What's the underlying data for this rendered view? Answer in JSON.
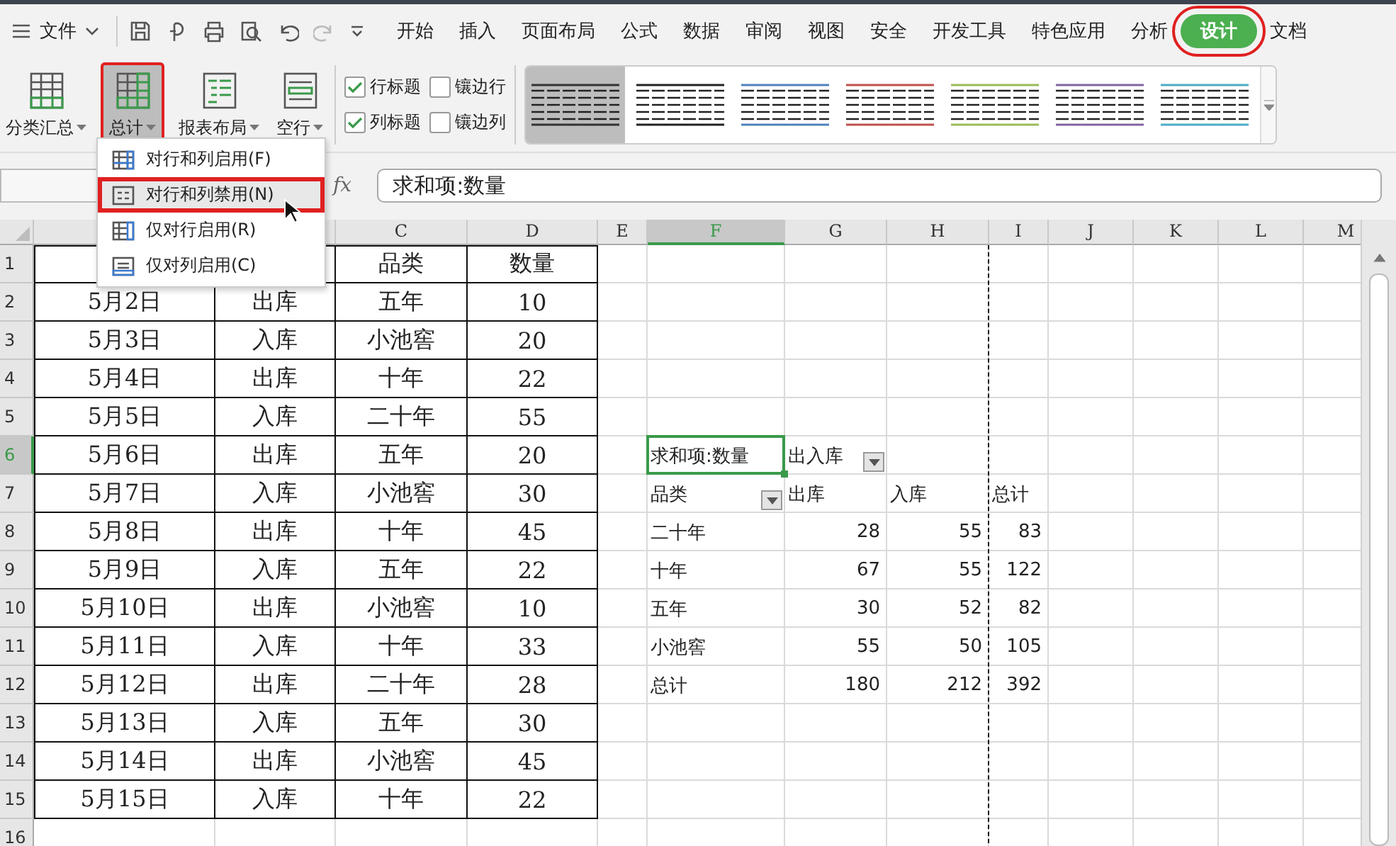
{
  "menu_bar": {
    "file_menu": "文件",
    "tabs": [
      {
        "label": "开始",
        "selected": false,
        "annotated": false
      },
      {
        "label": "插入",
        "selected": false,
        "annotated": false
      },
      {
        "label": "页面布局",
        "selected": false,
        "annotated": false
      },
      {
        "label": "公式",
        "selected": false,
        "annotated": false
      },
      {
        "label": "数据",
        "selected": false,
        "annotated": false
      },
      {
        "label": "审阅",
        "selected": false,
        "annotated": false
      },
      {
        "label": "视图",
        "selected": false,
        "annotated": false
      },
      {
        "label": "安全",
        "selected": false,
        "annotated": false
      },
      {
        "label": "开发工具",
        "selected": false,
        "annotated": false
      },
      {
        "label": "特色应用",
        "selected": false,
        "annotated": false
      },
      {
        "label": "分析",
        "selected": false,
        "annotated": false
      },
      {
        "label": "设计",
        "selected": true,
        "annotated": true
      },
      {
        "label": "文档",
        "selected": false,
        "annotated": false
      }
    ]
  },
  "ribbon": {
    "buttons": [
      {
        "label": "分类汇总",
        "pressed": false,
        "annotated": false
      },
      {
        "label": "总计",
        "pressed": true,
        "annotated": true
      },
      {
        "label": "报表布局",
        "pressed": false,
        "annotated": false
      },
      {
        "label": "空行",
        "pressed": false,
        "annotated": false
      }
    ],
    "checkboxes": [
      {
        "label": "行标题",
        "checked": true
      },
      {
        "label": "镶边行",
        "checked": false
      },
      {
        "label": "列标题",
        "checked": true
      },
      {
        "label": "镶边列",
        "checked": false
      }
    ],
    "styles": [
      {
        "color": "#333333",
        "selected": true
      },
      {
        "color": "#222222",
        "selected": false
      },
      {
        "color": "#4f81bd",
        "selected": false
      },
      {
        "color": "#c0504d",
        "selected": false
      },
      {
        "color": "#9bbb59",
        "selected": false
      },
      {
        "color": "#8064a2",
        "selected": false
      },
      {
        "color": "#4bacc6",
        "selected": false
      }
    ]
  },
  "formula_bar": {
    "fx": "fx",
    "value": "求和项:数量"
  },
  "dropdown_menu": {
    "items": [
      {
        "label": "对行和列启用(F)",
        "selected": false,
        "annotated": false
      },
      {
        "label": "对行和列禁用(N)",
        "selected": true,
        "annotated": true
      },
      {
        "label": "仅对行启用(R)",
        "selected": false,
        "annotated": false
      },
      {
        "label": "仅对列启用(C)",
        "selected": false,
        "annotated": false
      }
    ]
  },
  "sheet": {
    "columns": [
      {
        "selected": false
      },
      {
        "selected": false
      },
      {
        "label": "C",
        "selected": false
      },
      {
        "label": "D",
        "selected": false
      },
      {
        "label": "E",
        "selected": false
      },
      {
        "label": "F",
        "selected": true
      },
      {
        "label": "G",
        "selected": false
      },
      {
        "label": "H",
        "selected": false,
        "page_break_after": true
      },
      {
        "label": "I",
        "selected": false
      },
      {
        "label": "J",
        "selected": false
      },
      {
        "label": "K",
        "selected": false
      },
      {
        "label": "L",
        "selected": false
      },
      {
        "label": "M",
        "selected": false
      }
    ],
    "rows": [
      {
        "number": "1",
        "selected": false,
        "cells": [
          {
            "kind": "data"
          },
          {
            "kind": "data"
          },
          {
            "kind": "data",
            "text": "品类"
          },
          {
            "kind": "data",
            "text": "数量"
          }
        ]
      },
      {
        "number": "2",
        "selected": false,
        "cells": [
          {
            "kind": "data",
            "text": "5月2日"
          },
          {
            "kind": "data",
            "text": "出库"
          },
          {
            "kind": "data",
            "text": "五年"
          },
          {
            "kind": "data",
            "text": "10"
          }
        ]
      },
      {
        "number": "3",
        "selected": false,
        "cells": [
          {
            "kind": "data",
            "text": "5月3日"
          },
          {
            "kind": "data",
            "text": "入库"
          },
          {
            "kind": "data",
            "text": "小池窖"
          },
          {
            "kind": "data",
            "text": "20"
          }
        ]
      },
      {
        "number": "4",
        "selected": false,
        "cells": [
          {
            "kind": "data",
            "text": "5月4日"
          },
          {
            "kind": "data",
            "text": "出库"
          },
          {
            "kind": "data",
            "text": "十年"
          },
          {
            "kind": "data",
            "text": "22"
          }
        ]
      },
      {
        "number": "5",
        "selected": false,
        "cells": [
          {
            "kind": "data",
            "text": "5月5日"
          },
          {
            "kind": "data",
            "text": "入库"
          },
          {
            "kind": "data",
            "text": "二十年"
          },
          {
            "kind": "data",
            "text": "55"
          }
        ]
      },
      {
        "number": "6",
        "selected": true,
        "cells": [
          {
            "kind": "data",
            "text": "5月6日"
          },
          {
            "kind": "data",
            "text": "出库"
          },
          {
            "kind": "data",
            "text": "五年"
          },
          {
            "kind": "data",
            "text": "20"
          },
          {},
          {
            "kind": "pivot",
            "text": "求和项:数量"
          },
          {
            "kind": "pivot",
            "text": "出入库",
            "dropdown": true
          },
          {
            "kind": "pivot"
          },
          {
            "kind": "pivot"
          }
        ]
      },
      {
        "number": "7",
        "selected": false,
        "cells": [
          {
            "kind": "data",
            "text": "5月7日"
          },
          {
            "kind": "data",
            "text": "入库"
          },
          {
            "kind": "data",
            "text": "小池窖"
          },
          {
            "kind": "data",
            "text": "30"
          },
          {},
          {
            "kind": "pivot",
            "text": "品类",
            "dropdown": true
          },
          {
            "kind": "pivot",
            "text": "出库"
          },
          {
            "kind": "pivot",
            "text": "入库"
          },
          {
            "kind": "pivot",
            "text": "总计"
          }
        ]
      },
      {
        "number": "8",
        "selected": false,
        "cells": [
          {
            "kind": "data",
            "text": "5月8日"
          },
          {
            "kind": "data",
            "text": "出库"
          },
          {
            "kind": "data",
            "text": "十年"
          },
          {
            "kind": "data",
            "text": "45"
          },
          {},
          {
            "kind": "pivot",
            "text": "二十年"
          },
          {
            "kind": "pivot-num",
            "text": "28"
          },
          {
            "kind": "pivot-num",
            "text": "55"
          },
          {
            "kind": "pivot-num",
            "text": "83"
          }
        ]
      },
      {
        "number": "9",
        "selected": false,
        "cells": [
          {
            "kind": "data",
            "text": "5月9日"
          },
          {
            "kind": "data",
            "text": "入库"
          },
          {
            "kind": "data",
            "text": "五年"
          },
          {
            "kind": "data",
            "text": "22"
          },
          {},
          {
            "kind": "pivot",
            "text": "十年"
          },
          {
            "kind": "pivot-num",
            "text": "67"
          },
          {
            "kind": "pivot-num",
            "text": "55"
          },
          {
            "kind": "pivot-num",
            "text": "122"
          }
        ]
      },
      {
        "number": "10",
        "selected": false,
        "cells": [
          {
            "kind": "data",
            "text": "5月10日"
          },
          {
            "kind": "data",
            "text": "出库"
          },
          {
            "kind": "data",
            "text": "小池窖"
          },
          {
            "kind": "data",
            "text": "10"
          },
          {},
          {
            "kind": "pivot",
            "text": "五年"
          },
          {
            "kind": "pivot-num",
            "text": "30"
          },
          {
            "kind": "pivot-num",
            "text": "52"
          },
          {
            "kind": "pivot-num",
            "text": "82"
          }
        ]
      },
      {
        "number": "11",
        "selected": false,
        "cells": [
          {
            "kind": "data",
            "text": "5月11日"
          },
          {
            "kind": "data",
            "text": "入库"
          },
          {
            "kind": "data",
            "text": "十年"
          },
          {
            "kind": "data",
            "text": "33"
          },
          {},
          {
            "kind": "pivot",
            "text": "小池窖"
          },
          {
            "kind": "pivot-num",
            "text": "55"
          },
          {
            "kind": "pivot-num",
            "text": "50"
          },
          {
            "kind": "pivot-num",
            "text": "105"
          }
        ]
      },
      {
        "number": "12",
        "selected": false,
        "cells": [
          {
            "kind": "data",
            "text": "5月12日"
          },
          {
            "kind": "data",
            "text": "出库"
          },
          {
            "kind": "data",
            "text": "二十年"
          },
          {
            "kind": "data",
            "text": "28"
          },
          {},
          {
            "kind": "pivot",
            "text": "总计"
          },
          {
            "kind": "pivot-num",
            "text": "180"
          },
          {
            "kind": "pivot-num",
            "text": "212"
          },
          {
            "kind": "pivot-num",
            "text": "392"
          }
        ]
      },
      {
        "number": "13",
        "selected": false,
        "cells": [
          {
            "kind": "data",
            "text": "5月13日"
          },
          {
            "kind": "data",
            "text": "入库"
          },
          {
            "kind": "data",
            "text": "五年"
          },
          {
            "kind": "data",
            "text": "30"
          }
        ]
      },
      {
        "number": "14",
        "selected": false,
        "cells": [
          {
            "kind": "data",
            "text": "5月14日"
          },
          {
            "kind": "data",
            "text": "出库"
          },
          {
            "kind": "data",
            "text": "小池窖"
          },
          {
            "kind": "data",
            "text": "45"
          }
        ]
      },
      {
        "number": "15",
        "selected": false,
        "cells": [
          {
            "kind": "data",
            "text": "5月15日"
          },
          {
            "kind": "data",
            "text": "入库"
          },
          {
            "kind": "data",
            "text": "十年"
          },
          {
            "kind": "data",
            "text": "22"
          }
        ]
      },
      {
        "number": "16",
        "selected": false,
        "cells": []
      }
    ]
  }
}
